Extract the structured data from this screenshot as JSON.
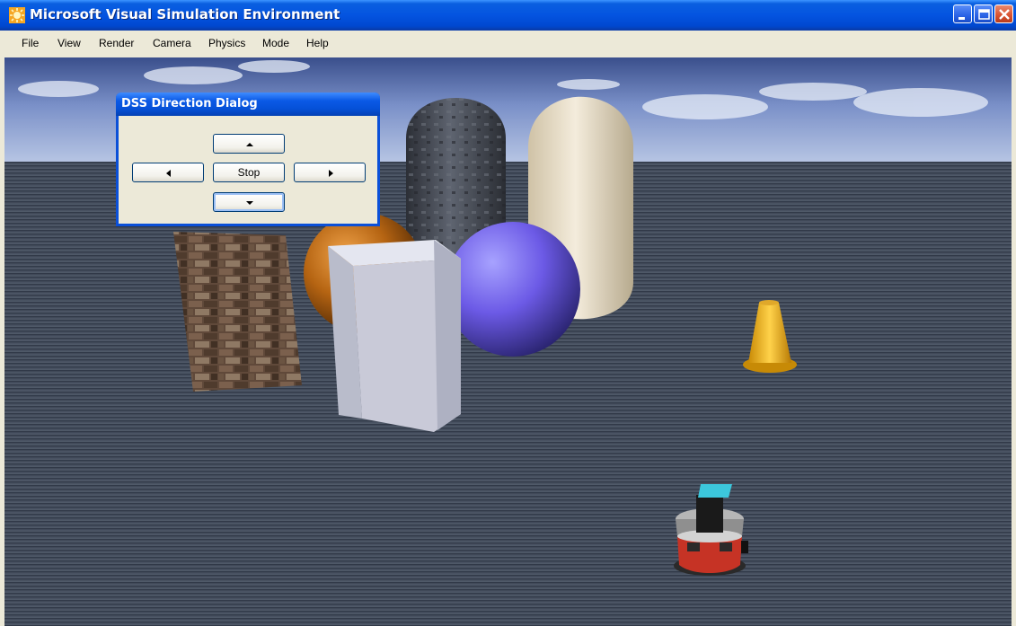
{
  "window": {
    "title": "Microsoft Visual Simulation Environment"
  },
  "menu": {
    "items": [
      "File",
      "View",
      "Render",
      "Camera",
      "Physics",
      "Mode",
      "Help"
    ]
  },
  "dialog": {
    "title": "DSS Direction Dialog",
    "stop_label": "Stop",
    "buttons": [
      "up-arrow-icon",
      "left-arrow-icon",
      "right-arrow-icon",
      "down-arrow-icon"
    ]
  },
  "scene": {
    "objects": [
      "sky",
      "textured ground plane",
      "stone brick wall",
      "dark stone capsule",
      "cream capsule",
      "orange sphere",
      "purple sphere",
      "white box",
      "yellow traffic cone",
      "red mobile robot"
    ]
  },
  "colors": {
    "titlebar": "#0454e0",
    "dialog_border": "#0b50d8",
    "ground": "#4a5563",
    "cone": "#f0b21c",
    "robot": "#c83a2a"
  }
}
